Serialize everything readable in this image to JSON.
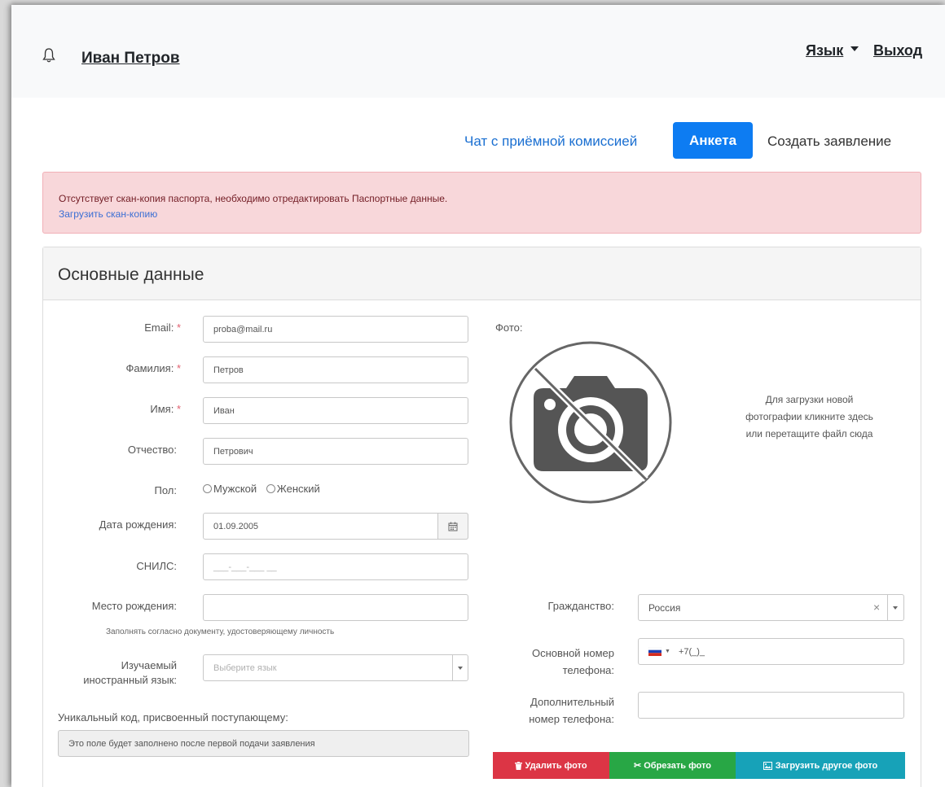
{
  "navbar": {
    "user_name": "Иван Петров",
    "lang_label": "Язык",
    "logout_label": "Выход"
  },
  "tabs": {
    "chat_label": "Чат с приёмной комиссией",
    "profile_label": "Анкета",
    "create_label": "Создать заявление"
  },
  "alert": {
    "message": "Отсутствует скан-копия паспорта, необходимо отредактировать Паспортные данные.",
    "link_label": "Загрузить скан-копию"
  },
  "card": {
    "title": "Основные данные"
  },
  "form": {
    "email_label": "Email:",
    "email_value": "proba@mail.ru",
    "surname_label": "Фамилия:",
    "surname_value": "Петров",
    "name_label": "Имя:",
    "name_value": "Иван",
    "patronymic_label": "Отчество:",
    "patronymic_value": "Петрович",
    "gender_label": "Пол:",
    "gender_male": "Мужской",
    "gender_female": "Женский",
    "birthdate_label": "Дата рождения:",
    "birthdate_value": "01.09.2005",
    "snils_label": "СНИЛС:",
    "snils_placeholder": "___-___-___ __",
    "birthplace_label": "Место рождения:",
    "birthplace_hint": "Заполнять согласно документу, удостоверяющему личность",
    "language_label_1": "Изучаемый",
    "language_label_2": "иностранный язык:",
    "language_placeholder": "Выберите язык",
    "unique_code_label": "Уникальный код, присвоенный поступающему:",
    "unique_code_value": "Это поле будет заполнено после первой подачи заявления",
    "required_mark": "*"
  },
  "photo": {
    "label": "Фото:",
    "drop_text_1": "Для загрузки новой",
    "drop_text_2": "фотографии кликните здесь",
    "drop_text_3": "или перетащите файл сюда",
    "delete_label": "Удалить фото",
    "crop_label": "Обрезать фото",
    "upload_label": "Загрузить другое фото",
    "delete_color": "#dc3545",
    "crop_color": "#28a745",
    "upload_color": "#17a2b8"
  },
  "contacts": {
    "citizenship_label": "Гражданство:",
    "citizenship_value": "Россия",
    "clear_symbol": "×",
    "main_phone_label_1": "Основной номер",
    "main_phone_label_2": "телефона:",
    "main_phone_value": "+7(_)_",
    "extra_phone_label_1": "Дополнительный",
    "extra_phone_label_2": "номер телефона:"
  }
}
